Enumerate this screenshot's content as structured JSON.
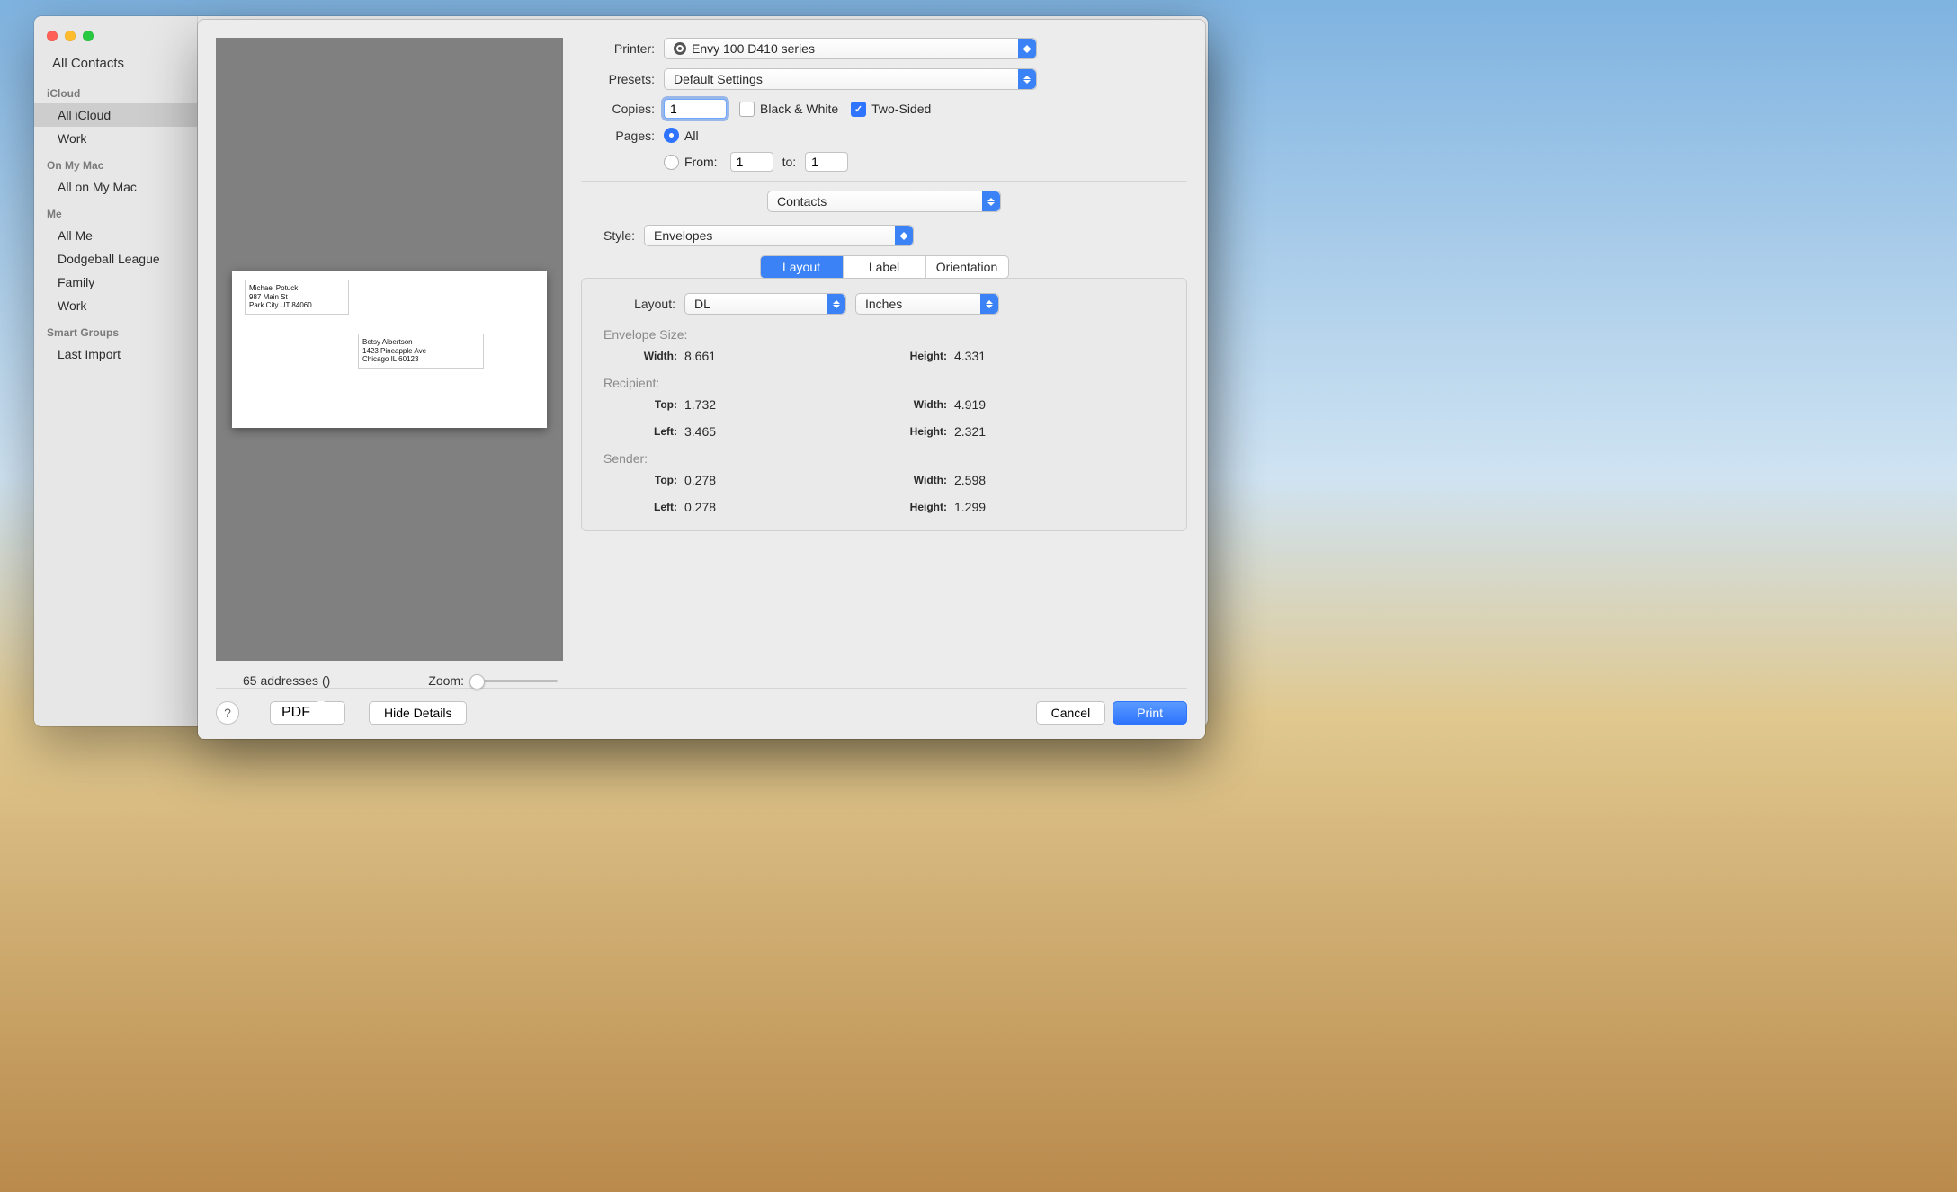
{
  "contacts": {
    "top": "All Contacts",
    "sections": {
      "icloud": {
        "header": "iCloud",
        "items": [
          "All iCloud",
          "Work"
        ],
        "selected": 0
      },
      "onmymac": {
        "header": "On My Mac",
        "items": [
          "All on My Mac"
        ]
      },
      "me": {
        "header": "Me",
        "items": [
          "All Me",
          "Dodgeball League",
          "Family",
          "Work"
        ]
      },
      "smart": {
        "header": "Smart Groups",
        "items": [
          "Last Import"
        ]
      }
    }
  },
  "print": {
    "labels": {
      "printer": "Printer:",
      "presets": "Presets:",
      "copies": "Copies:",
      "bw": "Black & White",
      "twosided": "Two-Sided",
      "pages": "Pages:",
      "all": "All",
      "from": "From:",
      "to": "to:",
      "style": "Style:",
      "layout": "Layout:",
      "envelope_size": "Envelope Size:",
      "recipient": "Recipient:",
      "sender": "Sender:",
      "width": "Width:",
      "height": "Height:",
      "top": "Top:",
      "left": "Left:",
      "zoom": "Zoom:",
      "segments": {
        "layout": "Layout",
        "label": "Label",
        "orientation": "Orientation"
      }
    },
    "printer": "Envy 100 D410 series",
    "presets": "Default Settings",
    "copies": "1",
    "bw_checked": false,
    "twosided_checked": true,
    "pages_all_selected": true,
    "pages_from": "1",
    "pages_to": "1",
    "app": "Contacts",
    "style": "Envelopes",
    "layout_value": "DL",
    "units": "Inches",
    "env": {
      "width": "8.661",
      "height": "4.331"
    },
    "recipient": {
      "top": "1.732",
      "left": "3.465",
      "width": "4.919",
      "height": "2.321"
    },
    "sender": {
      "top": "0.278",
      "left": "0.278",
      "width": "2.598",
      "height": "1.299"
    },
    "preview": {
      "count_text": "65 addresses ()",
      "sender": {
        "name": "Michael Potuck",
        "street": "987 Main St",
        "city": "Park City UT 84060"
      },
      "recipient": {
        "name": "Betsy Albertson",
        "street": "1423 Pineapple Ave",
        "city": "Chicago IL 60123"
      }
    },
    "footer": {
      "pdf": "PDF",
      "hide": "Hide Details",
      "cancel": "Cancel",
      "print": "Print",
      "help": "?"
    }
  }
}
